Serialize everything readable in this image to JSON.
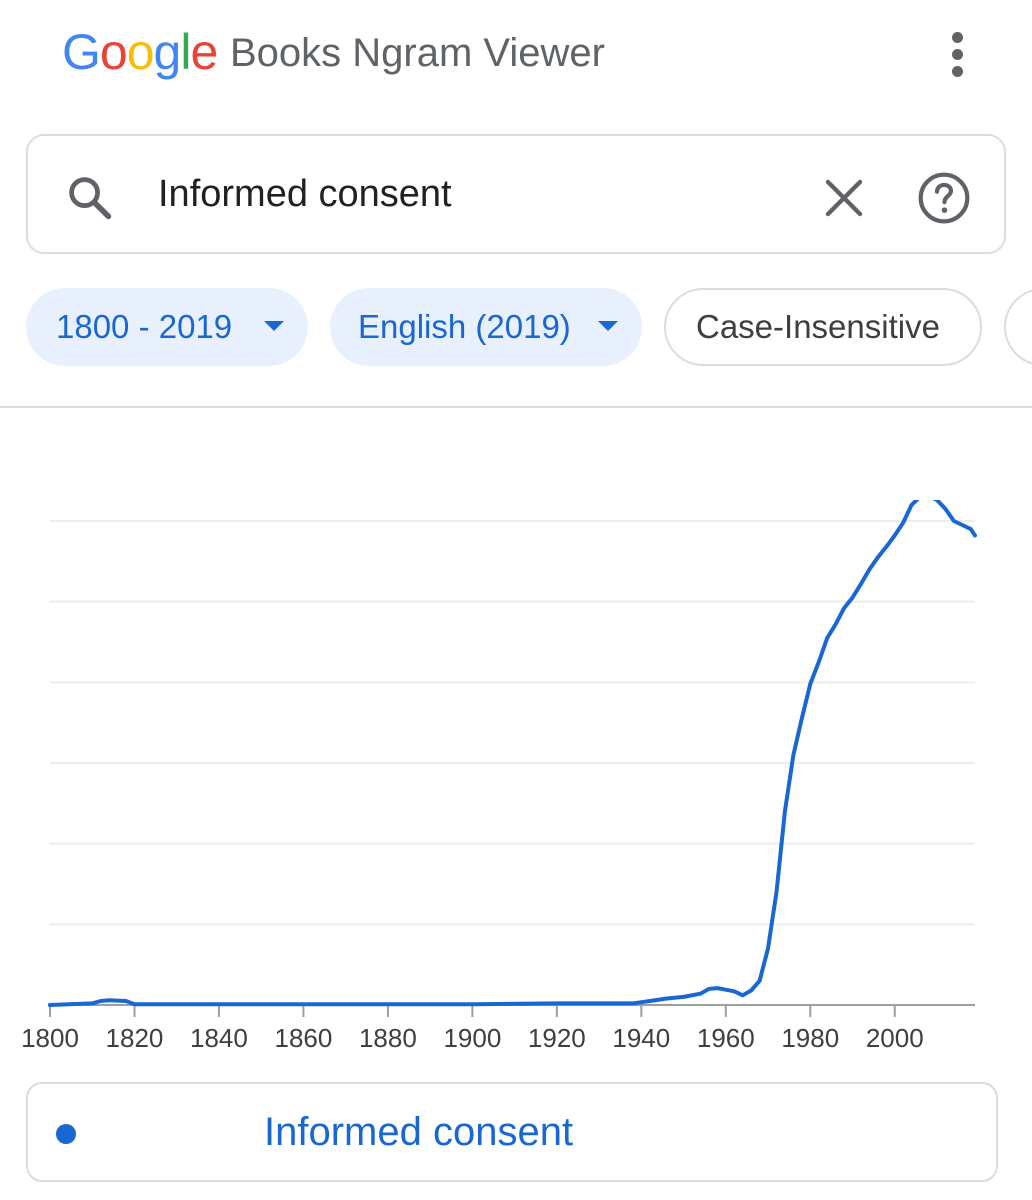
{
  "header": {
    "logo_text": "Google",
    "app_name": "Books Ngram Viewer",
    "menu_icon": "more-vert-icon",
    "logo_colors": [
      "#4285F4",
      "#EA4335",
      "#FBBC05",
      "#4285F4",
      "#34A853",
      "#EA4335"
    ]
  },
  "search": {
    "value": "Informed consent",
    "icons": {
      "search": "search-icon",
      "clear": "close-icon",
      "help": "help-icon"
    }
  },
  "filters": {
    "year_range": "1800 - 2019",
    "corpus": "English (2019)",
    "case": "Case-Insensitive"
  },
  "colors": {
    "accent": "#1967d2",
    "chip_bg": "#e8f0fe",
    "border": "#dadce0"
  },
  "chart_data": {
    "type": "line",
    "title": "",
    "xlabel": "",
    "ylabel": "",
    "xlim": [
      1800,
      2019
    ],
    "ylim": [
      0,
      6
    ],
    "grid": true,
    "x_ticks": [
      "1800",
      "1820",
      "1840",
      "1860",
      "1880",
      "1900",
      "1920",
      "1940",
      "1960",
      "1980",
      "2000"
    ],
    "series": [
      {
        "name": "Informed consent",
        "color": "#1967d2",
        "x": [
          1800,
          1810,
          1812,
          1814,
          1818,
          1820,
          1840,
          1860,
          1880,
          1900,
          1920,
          1930,
          1938,
          1942,
          1946,
          1950,
          1954,
          1956,
          1958,
          1960,
          1962,
          1964,
          1966,
          1968,
          1970,
          1972,
          1974,
          1976,
          1978,
          1980,
          1982,
          1984,
          1986,
          1988,
          1990,
          1992,
          1994,
          1996,
          1998,
          2000,
          2002,
          2004,
          2006,
          2008,
          2010,
          2012,
          2014,
          2016,
          2018,
          2019
        ],
        "y": [
          0.0,
          0.02,
          0.05,
          0.06,
          0.05,
          0.01,
          0.01,
          0.01,
          0.01,
          0.01,
          0.02,
          0.02,
          0.02,
          0.05,
          0.08,
          0.1,
          0.14,
          0.2,
          0.21,
          0.19,
          0.17,
          0.12,
          0.18,
          0.3,
          0.7,
          1.4,
          2.4,
          3.1,
          3.55,
          3.98,
          4.25,
          4.55,
          4.72,
          4.92,
          5.05,
          5.22,
          5.4,
          5.55,
          5.68,
          5.82,
          5.98,
          6.2,
          6.3,
          6.31,
          6.26,
          6.15,
          6.0,
          5.95,
          5.9,
          5.82
        ]
      }
    ]
  },
  "legend": {
    "label": "Informed consent"
  }
}
